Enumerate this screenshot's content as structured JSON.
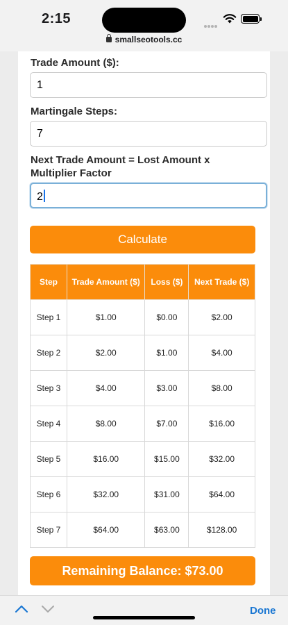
{
  "status_bar": {
    "time": "2:15"
  },
  "browser": {
    "url": "smallseotools.cc"
  },
  "form": {
    "trade_amount_label": "Trade Amount ($):",
    "trade_amount_value": "1",
    "steps_label": "Martingale Steps:",
    "steps_value": "7",
    "multiplier_label_line1": "Next Trade Amount = Lost Amount x",
    "multiplier_label_line2": "Multiplier Factor",
    "multiplier_value": "2",
    "calculate_label": "Calculate"
  },
  "table": {
    "headers": [
      "Step",
      "Trade Amount ($)",
      "Loss ($)",
      "Next Trade ($)"
    ],
    "rows": [
      [
        "Step 1",
        "$1.00",
        "$0.00",
        "$2.00"
      ],
      [
        "Step 2",
        "$2.00",
        "$1.00",
        "$4.00"
      ],
      [
        "Step 3",
        "$4.00",
        "$3.00",
        "$8.00"
      ],
      [
        "Step 4",
        "$8.00",
        "$7.00",
        "$16.00"
      ],
      [
        "Step 5",
        "$16.00",
        "$15.00",
        "$32.00"
      ],
      [
        "Step 6",
        "$32.00",
        "$31.00",
        "$64.00"
      ],
      [
        "Step 7",
        "$64.00",
        "$63.00",
        "$128.00"
      ]
    ]
  },
  "balance_text": "Remaining Balance: $73.00",
  "toolbar": {
    "done_label": "Done",
    "prev_icon": "chevron-up-icon",
    "next_icon": "chevron-down-icon"
  },
  "colors": {
    "accent": "#fb8c0b",
    "link": "#1976d2",
    "focus": "#7ab0d8"
  }
}
